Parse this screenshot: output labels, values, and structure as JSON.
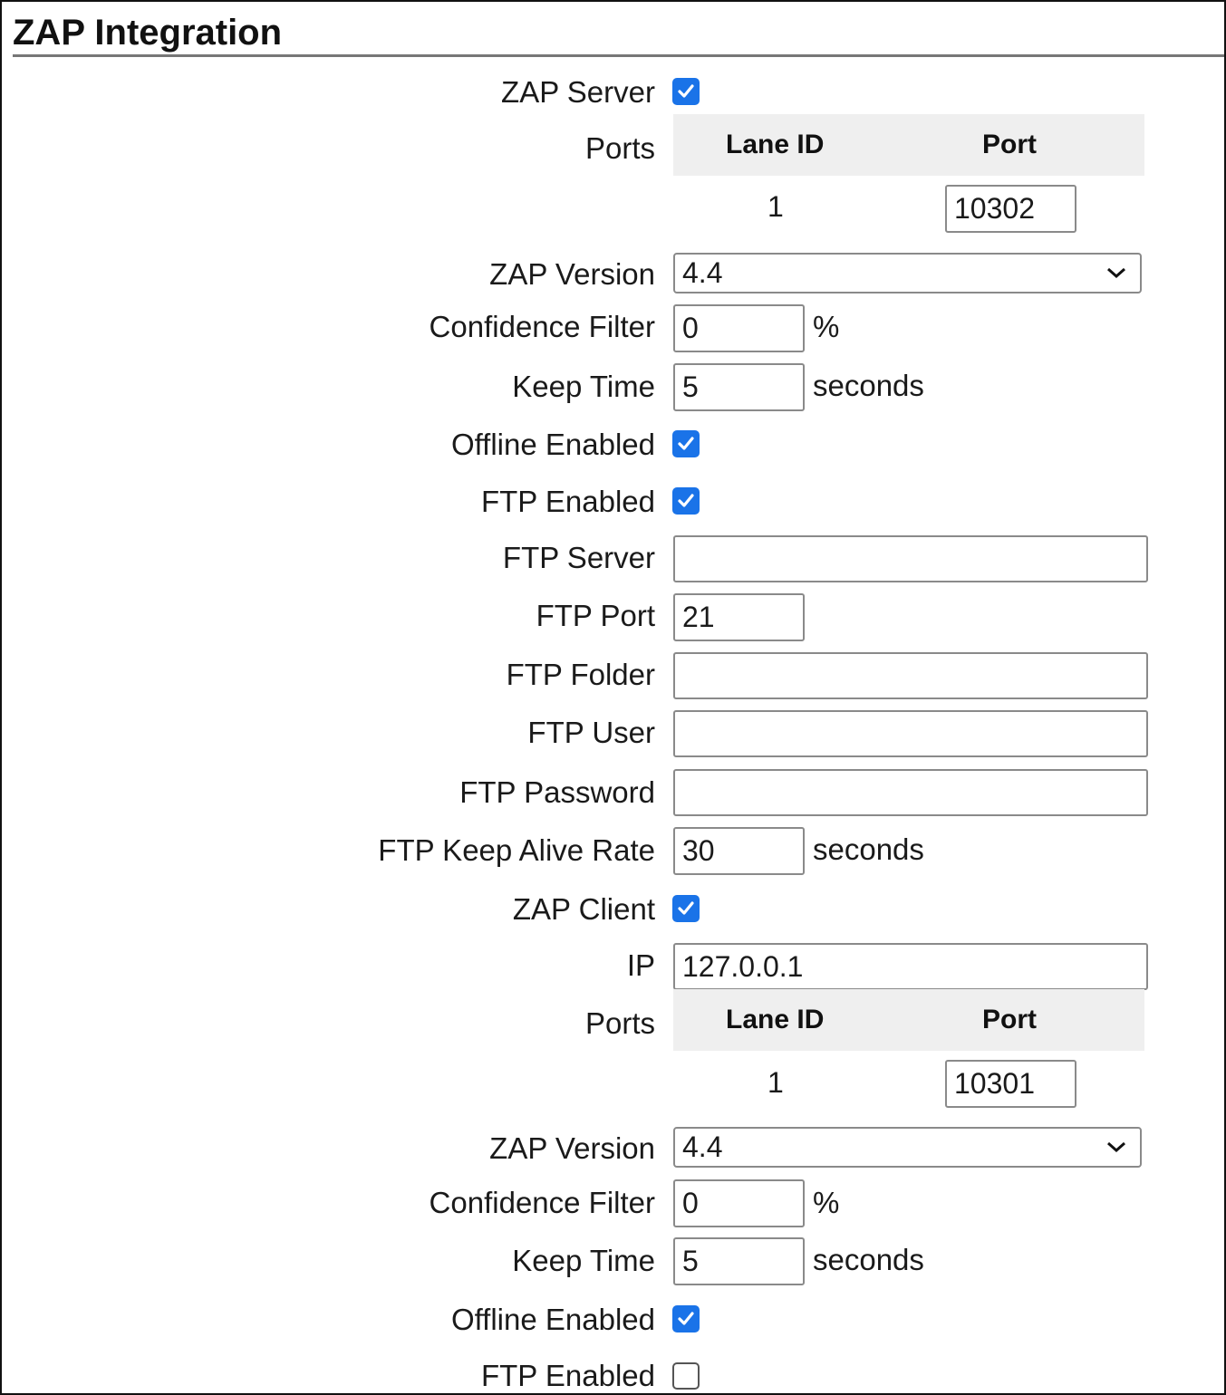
{
  "section_title": "ZAP Integration",
  "server": {
    "zap_server_label": "ZAP Server",
    "zap_server_checked": true,
    "ports_label": "Ports",
    "ports_table": {
      "headers": [
        "Lane ID",
        "Port"
      ],
      "rows": [
        {
          "lane_id": "1",
          "port": "10302"
        }
      ]
    },
    "zap_version_label": "ZAP Version",
    "zap_version_value": "4.4",
    "confidence_filter_label": "Confidence Filter",
    "confidence_filter_value": "0",
    "confidence_filter_unit": "%",
    "keep_time_label": "Keep Time",
    "keep_time_value": "5",
    "keep_time_unit": "seconds",
    "offline_enabled_label": "Offline Enabled",
    "offline_enabled_checked": true,
    "ftp_enabled_label": "FTP Enabled",
    "ftp_enabled_checked": true,
    "ftp_server_label": "FTP Server",
    "ftp_server_value": "",
    "ftp_port_label": "FTP Port",
    "ftp_port_value": "21",
    "ftp_folder_label": "FTP Folder",
    "ftp_folder_value": "",
    "ftp_user_label": "FTP User",
    "ftp_user_value": "",
    "ftp_password_label": "FTP Password",
    "ftp_password_value": "",
    "ftp_keep_alive_label": "FTP Keep Alive Rate",
    "ftp_keep_alive_value": "30",
    "ftp_keep_alive_unit": "seconds"
  },
  "client": {
    "zap_client_label": "ZAP Client",
    "zap_client_checked": true,
    "ip_label": "IP",
    "ip_value": "127.0.0.1",
    "ports_label": "Ports",
    "ports_table": {
      "headers": [
        "Lane ID",
        "Port"
      ],
      "rows": [
        {
          "lane_id": "1",
          "port": "10301"
        }
      ]
    },
    "zap_version_label": "ZAP Version",
    "zap_version_value": "4.4",
    "confidence_filter_label": "Confidence Filter",
    "confidence_filter_value": "0",
    "confidence_filter_unit": "%",
    "keep_time_label": "Keep Time",
    "keep_time_value": "5",
    "keep_time_unit": "seconds",
    "offline_enabled_label": "Offline Enabled",
    "offline_enabled_checked": true,
    "ftp_enabled_label": "FTP Enabled",
    "ftp_enabled_checked": false
  },
  "colors": {
    "checkbox_accent": "#1a73e8",
    "table_header_bg": "#efefef"
  },
  "icons": {
    "checkbox_checked": "check-icon",
    "select_arrow": "chevron-down-icon"
  }
}
